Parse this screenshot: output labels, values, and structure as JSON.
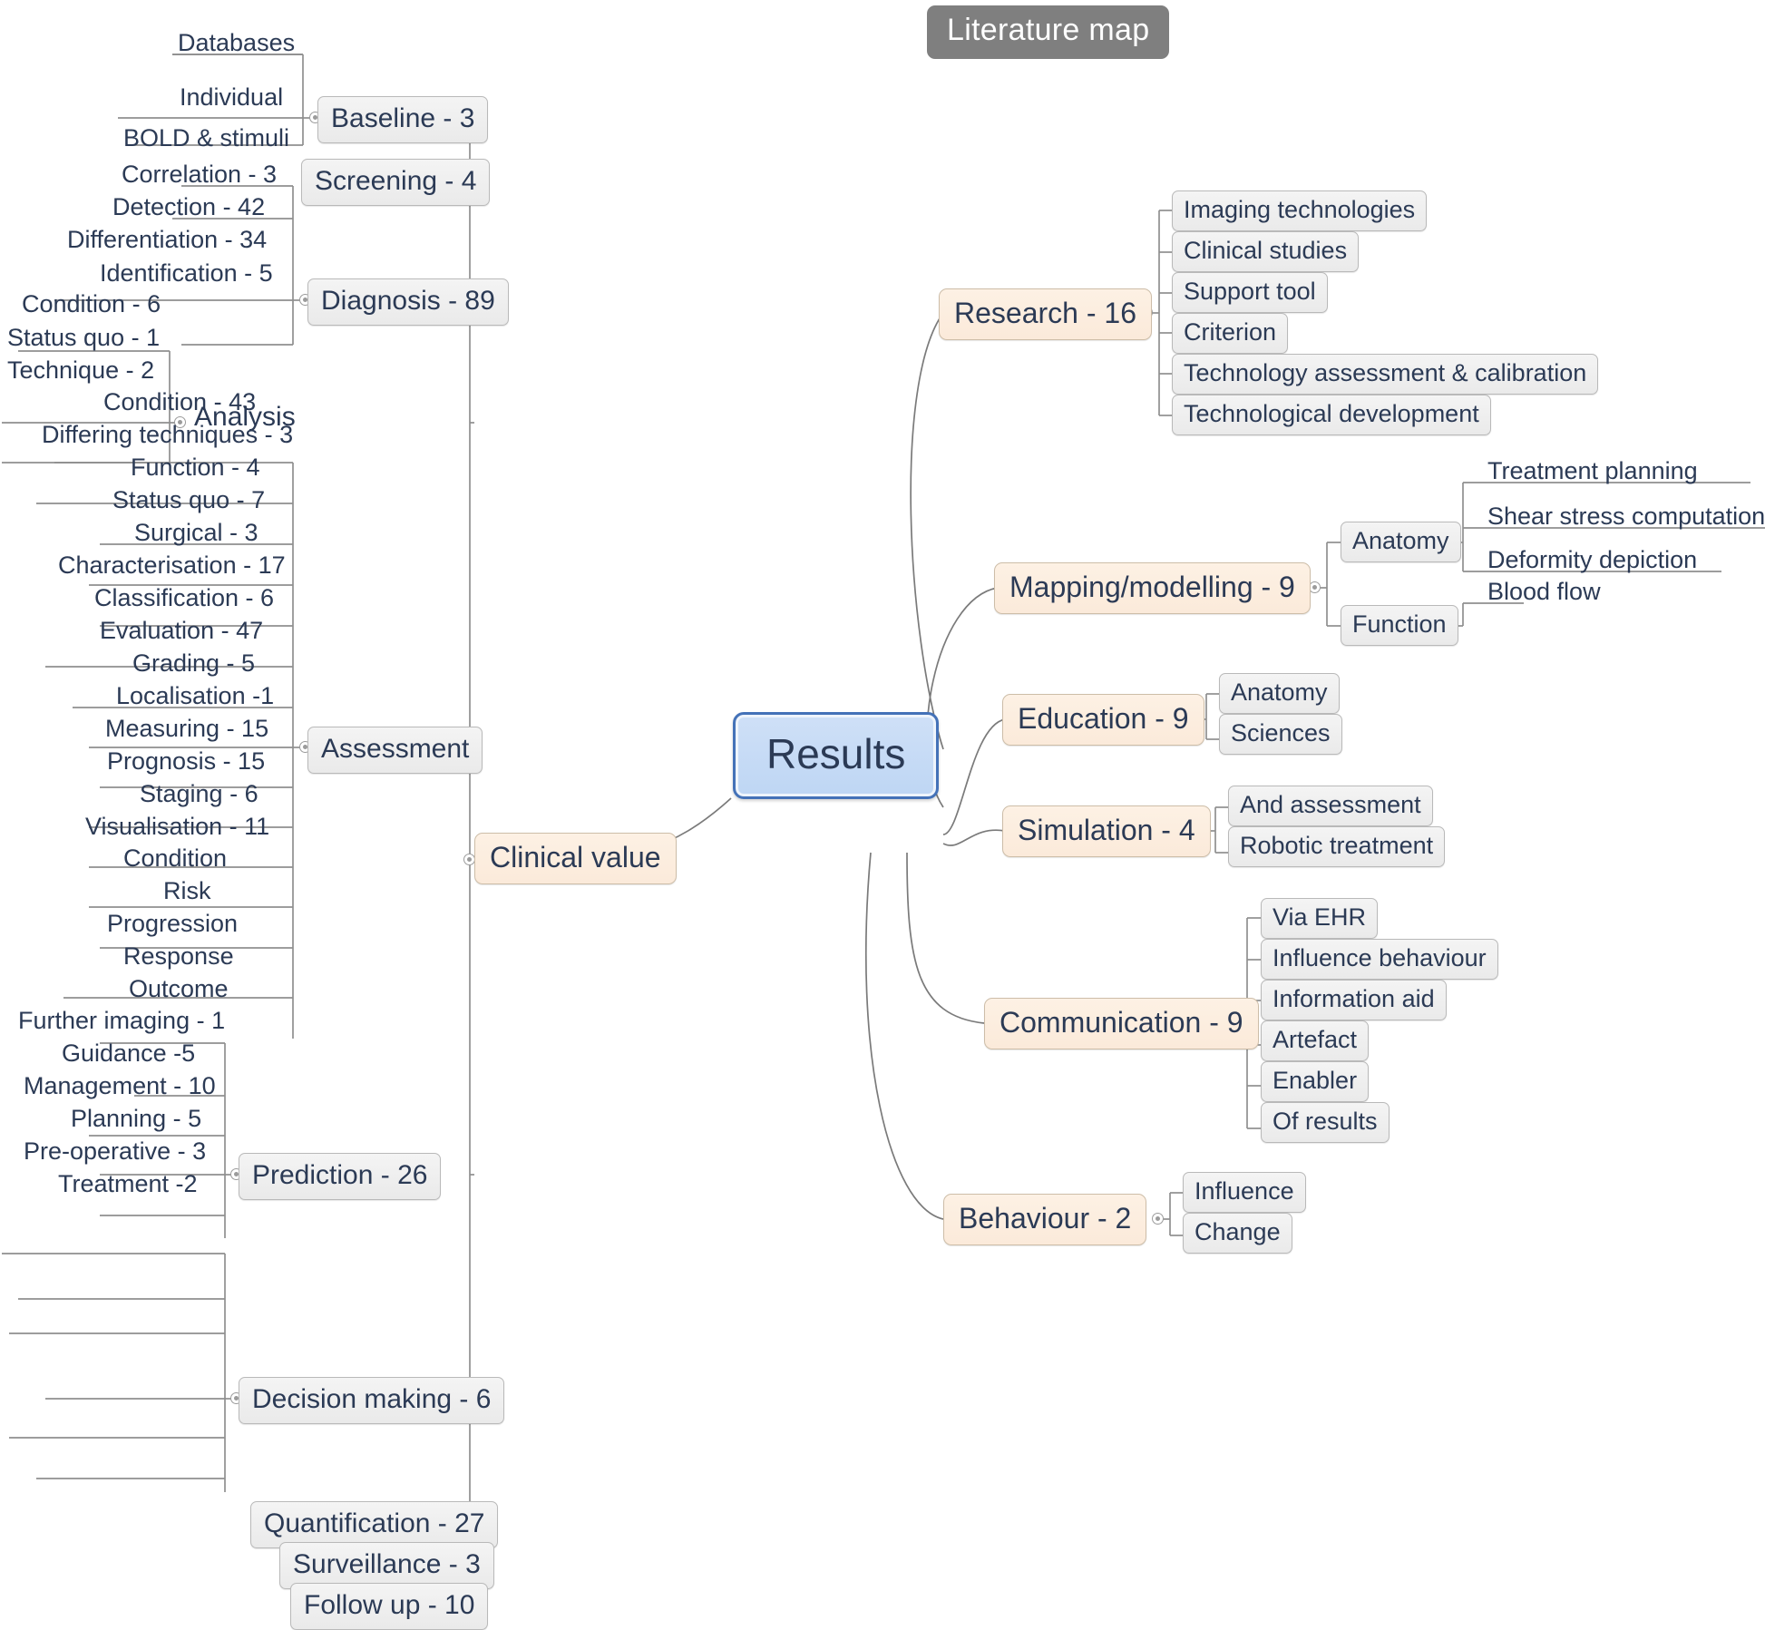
{
  "title": {
    "text": "Literature map"
  },
  "root": {
    "label": "Results"
  },
  "icons": {
    "collapse": "collapse-handle-icon"
  },
  "colors": {
    "root_fill": "#c6dbf5",
    "root_border": "#4472b8",
    "branch_fill": "#fbeada",
    "branch_border": "#cdbda8",
    "leaf_fill": "#efefef",
    "leaf_border": "#b9b9b9",
    "banner_fill": "#7f7f7f",
    "text": "#2b3a55",
    "link": "#8f8f8f"
  },
  "left_branch": {
    "label": "Clinical value",
    "children": [
      {
        "label": "Baseline - 3",
        "children": [
          {
            "label": "Databases"
          },
          {
            "label": "Individual"
          },
          {
            "label": "BOLD & stimuli"
          }
        ]
      },
      {
        "label": "Screening - 4",
        "children": []
      },
      {
        "label": "Diagnosis - 89",
        "children": [
          {
            "label": "Correlation - 3"
          },
          {
            "label": "Detection - 42"
          },
          {
            "label": "Differentiation - 34"
          },
          {
            "label": "Identification - 5"
          }
        ]
      },
      {
        "label": "Analysis",
        "children": [
          {
            "label": "Condition - 6"
          },
          {
            "label": "Status quo - 1"
          },
          {
            "label": "Technique - 2"
          }
        ]
      },
      {
        "label": "Assessment",
        "children": [
          {
            "label": "Condition - 43"
          },
          {
            "label": "Differing techniques - 3"
          },
          {
            "label": "Function - 4"
          },
          {
            "label": "Status quo - 7"
          },
          {
            "label": "Surgical - 3"
          },
          {
            "label": "Characterisation - 17"
          },
          {
            "label": "Classification - 6"
          },
          {
            "label": "Evaluation - 47"
          },
          {
            "label": "Grading - 5"
          },
          {
            "label": "Localisation -1"
          },
          {
            "label": "Measuring - 15"
          },
          {
            "label": "Prognosis - 15"
          },
          {
            "label": "Staging - 6"
          },
          {
            "label": "Visualisation - 11"
          }
        ]
      },
      {
        "label": "Prediction - 26",
        "children": [
          {
            "label": "Condition"
          },
          {
            "label": "Risk"
          },
          {
            "label": "Progression"
          },
          {
            "label": "Response"
          },
          {
            "label": "Outcome"
          }
        ]
      },
      {
        "label": "Decision making - 6",
        "children": [
          {
            "label": "Further imaging - 1"
          },
          {
            "label": "Guidance  -5"
          },
          {
            "label": "Management - 10"
          },
          {
            "label": "Planning - 5"
          },
          {
            "label": "Pre-operative - 3"
          },
          {
            "label": "Treatment -2"
          }
        ]
      },
      {
        "label": "Quantification - 27",
        "children": []
      },
      {
        "label": "Surveillance - 3",
        "children": []
      },
      {
        "label": "Follow up - 10",
        "children": []
      }
    ]
  },
  "right_branches": [
    {
      "label": "Research - 16",
      "children": [
        {
          "label": "Imaging technologies"
        },
        {
          "label": "Clinical studies"
        },
        {
          "label": "Support tool"
        },
        {
          "label": "Criterion"
        },
        {
          "label": "Technology assessment & calibration"
        },
        {
          "label": "Technological development"
        }
      ]
    },
    {
      "label": "Mapping/modelling - 9",
      "children": [
        {
          "label": "Anatomy",
          "children": [
            {
              "label": "Treatment planning"
            },
            {
              "label": "Shear stress computations"
            },
            {
              "label": "Deformity depiction"
            }
          ]
        },
        {
          "label": "Function",
          "children": [
            {
              "label": "Blood flow"
            }
          ]
        }
      ]
    },
    {
      "label": "Education - 9",
      "children": [
        {
          "label": "Anatomy"
        },
        {
          "label": "Sciences"
        }
      ]
    },
    {
      "label": "Simulation - 4",
      "children": [
        {
          "label": "And assessment"
        },
        {
          "label": "Robotic treatment"
        }
      ]
    },
    {
      "label": "Communication - 9",
      "children": [
        {
          "label": "Via EHR"
        },
        {
          "label": "Influence behaviour"
        },
        {
          "label": "Information aid"
        },
        {
          "label": "Artefact"
        },
        {
          "label": "Enabler"
        },
        {
          "label": "Of results"
        }
      ]
    },
    {
      "label": "Behaviour - 2",
      "children": [
        {
          "label": "Influence"
        },
        {
          "label": "Change"
        }
      ]
    }
  ]
}
